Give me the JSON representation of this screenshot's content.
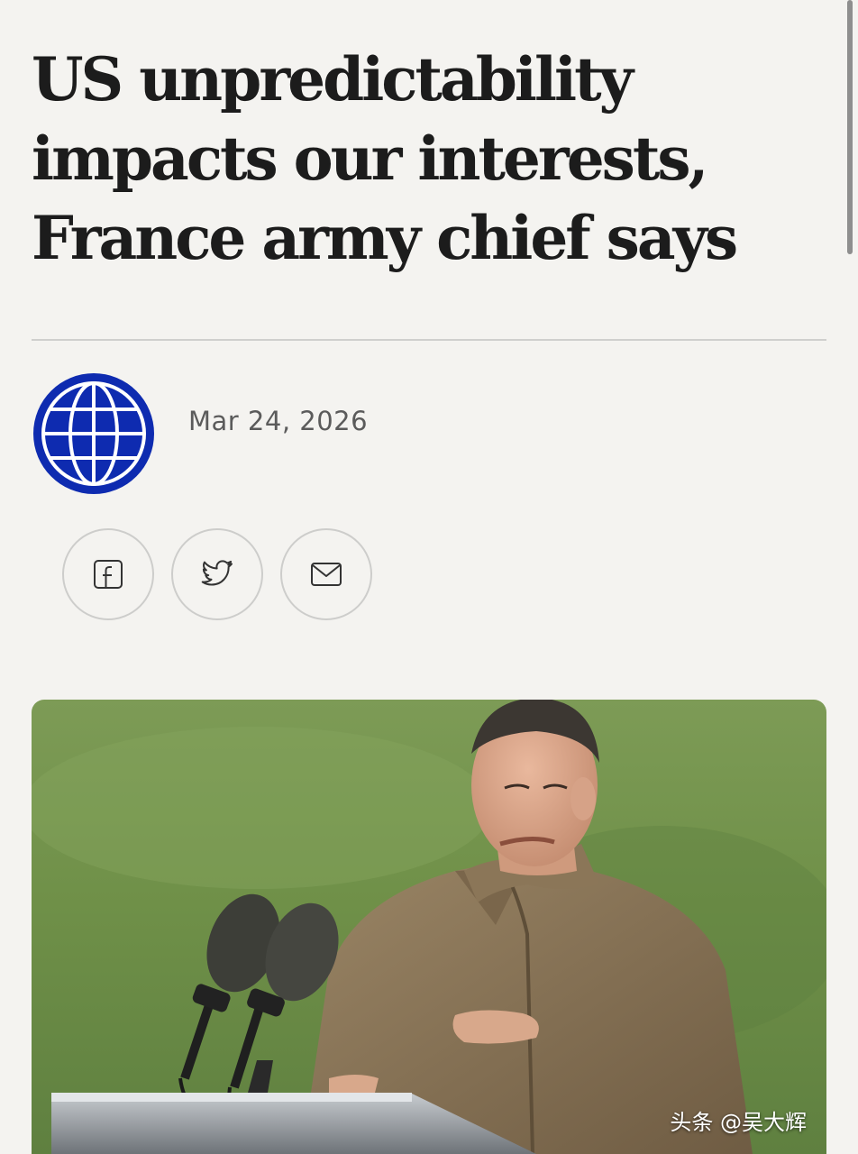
{
  "article": {
    "headline": "US unpredictability impacts our interests, France army chief says",
    "date": "Mar 24, 2026"
  },
  "publisher": {
    "avatar_icon": "globe-icon",
    "brand_color": "#0e2bb0"
  },
  "share": {
    "buttons": [
      {
        "icon": "facebook-icon"
      },
      {
        "icon": "twitter-icon"
      },
      {
        "icon": "mail-icon"
      }
    ]
  },
  "photo": {
    "watermark": "头条 @吴大辉"
  }
}
